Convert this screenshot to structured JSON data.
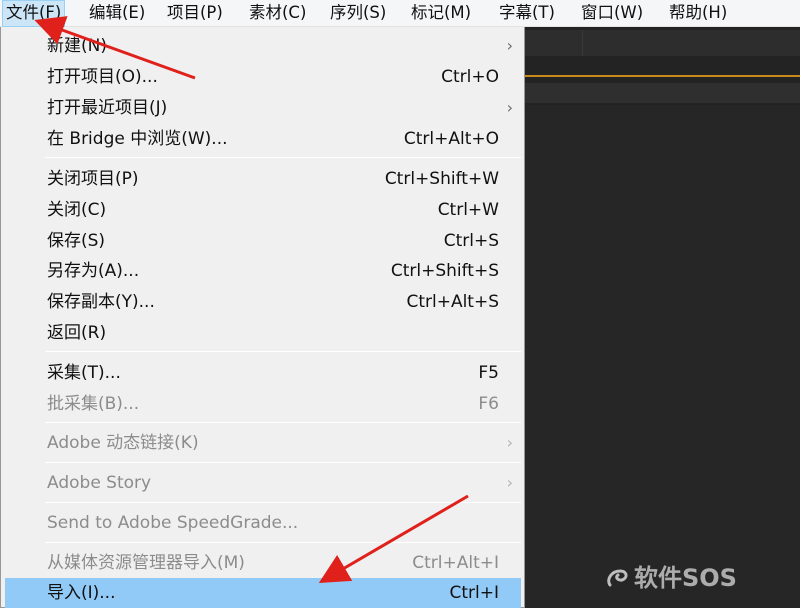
{
  "menubar": {
    "items": [
      {
        "label": "文件(F)",
        "active": true
      },
      {
        "label": "编辑(E)"
      },
      {
        "label": "项目(P)"
      },
      {
        "label": "素材(C)"
      },
      {
        "label": "序列(S)"
      },
      {
        "label": "标记(M)"
      },
      {
        "label": "字幕(T)"
      },
      {
        "label": "窗口(W)"
      },
      {
        "label": "帮助(H)"
      }
    ]
  },
  "file_menu": {
    "items": [
      {
        "label": "新建(N)",
        "shortcut": "",
        "submenu": true,
        "disabled": false
      },
      {
        "label": "打开项目(O)...",
        "shortcut": "Ctrl+O",
        "submenu": false,
        "disabled": false
      },
      {
        "label": "打开最近项目(J)",
        "shortcut": "",
        "submenu": true,
        "disabled": false
      },
      {
        "label": "在 Bridge 中浏览(W)...",
        "shortcut": "Ctrl+Alt+O",
        "submenu": false,
        "disabled": false
      },
      {
        "label": "关闭项目(P)",
        "shortcut": "Ctrl+Shift+W",
        "submenu": false,
        "disabled": false
      },
      {
        "label": "关闭(C)",
        "shortcut": "Ctrl+W",
        "submenu": false,
        "disabled": false
      },
      {
        "label": "保存(S)",
        "shortcut": "Ctrl+S",
        "submenu": false,
        "disabled": false
      },
      {
        "label": "另存为(A)...",
        "shortcut": "Ctrl+Shift+S",
        "submenu": false,
        "disabled": false
      },
      {
        "label": "保存副本(Y)...",
        "shortcut": "Ctrl+Alt+S",
        "submenu": false,
        "disabled": false
      },
      {
        "label": "返回(R)",
        "shortcut": "",
        "submenu": false,
        "disabled": false
      },
      {
        "label": "采集(T)...",
        "shortcut": "F5",
        "submenu": false,
        "disabled": false
      },
      {
        "label": "批采集(B)...",
        "shortcut": "F6",
        "submenu": false,
        "disabled": true
      },
      {
        "label": "Adobe 动态链接(K)",
        "shortcut": "",
        "submenu": true,
        "disabled": true
      },
      {
        "label": "Adobe Story",
        "shortcut": "",
        "submenu": true,
        "disabled": true
      },
      {
        "label": "Send to Adobe SpeedGrade...",
        "shortcut": "",
        "submenu": false,
        "disabled": true
      },
      {
        "label": "从媒体资源管理器导入(M)",
        "shortcut": "Ctrl+Alt+I",
        "submenu": false,
        "disabled": true
      },
      {
        "label": "导入(I)...",
        "shortcut": "Ctrl+I",
        "submenu": false,
        "disabled": false,
        "highlighted": true
      }
    ]
  },
  "watermark": {
    "text": "软件SOS"
  },
  "colors": {
    "menu_background": "#f0f0f0",
    "highlight": "#91c9f7",
    "annotation_arrow": "#e0201a",
    "app_background": "#232323",
    "accent_line": "#c88a1a"
  }
}
